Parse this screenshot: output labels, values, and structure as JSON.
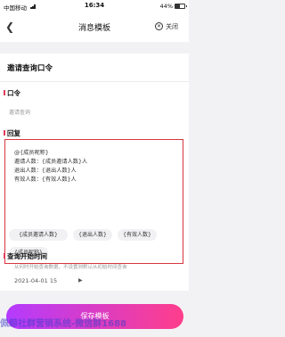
{
  "status_bar": {
    "carrier": "中国移动",
    "time": "16:34",
    "battery": "44%"
  },
  "nav": {
    "title": "消息模板",
    "close_label": "关闭"
  },
  "section": {
    "title": "邀请查询口令"
  },
  "command": {
    "label": "口令",
    "value": "邀请查询"
  },
  "reply": {
    "label": "回复",
    "text": "@{成员昵称}\n邀请人数：{成员邀请人数}人\n退出人数：{退出人数}人\n有效人数：{有效人数}人",
    "tags": [
      "{成员邀请人数}",
      "{退出人数}",
      "{有效人数}",
      "{成员昵称}"
    ]
  },
  "query_time": {
    "label": "查询开始时间",
    "description": "从何时开始查询数据，不设置则默认从初始时间查询",
    "date": "2021-04-01 15"
  },
  "save_button": "保存模板",
  "watermark": "佩鲸社群营销系统-微信群1688",
  "colors": {
    "accent": "#e23c5a",
    "highlight_border": "#d8363e",
    "button_gradient_start": "#b43bff",
    "button_gradient_end": "#ff3e8b"
  }
}
